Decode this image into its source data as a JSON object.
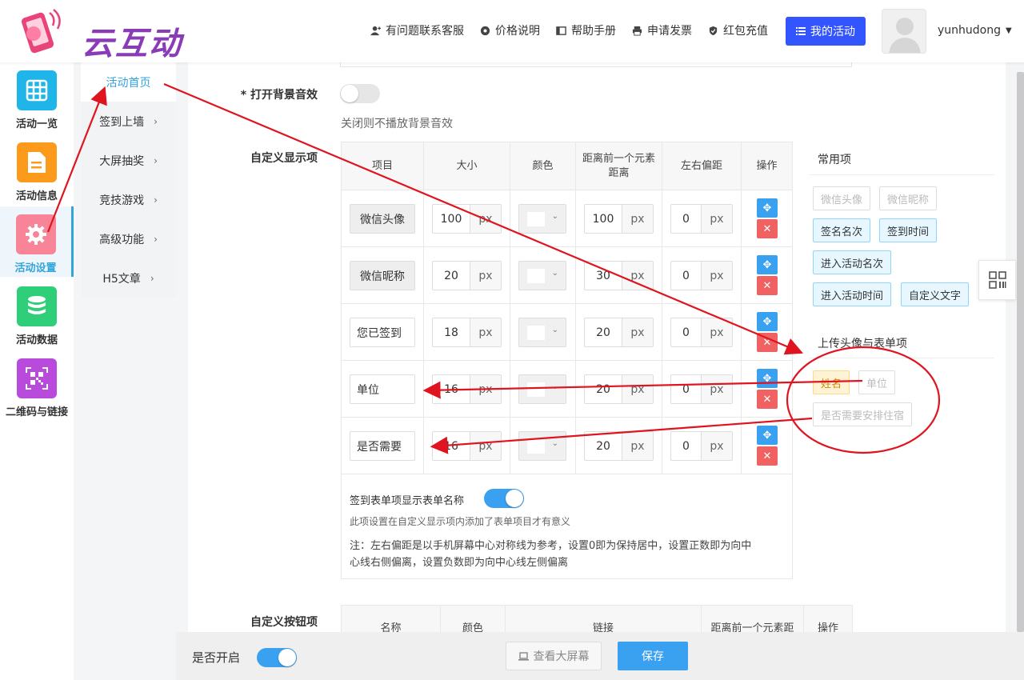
{
  "brand": {
    "name": "云互动"
  },
  "topnav": [
    {
      "label": "有问题联系客服",
      "icon": "user-plus-icon"
    },
    {
      "label": "价格说明",
      "icon": "gear-icon"
    },
    {
      "label": "帮助手册",
      "icon": "book-icon"
    },
    {
      "label": "申请发票",
      "icon": "printer-icon"
    },
    {
      "label": "红包充值",
      "icon": "shield-check-icon"
    }
  ],
  "my_activity_label": "我的活动",
  "username": "yunhudong",
  "sidenav": [
    {
      "label": "活动一览",
      "icon": "grid-icon",
      "color": "#1fb5e8"
    },
    {
      "label": "活动信息",
      "icon": "document-icon",
      "color": "#fb9a1b"
    },
    {
      "label": "活动设置",
      "icon": "gear-icon",
      "color": "#f78597",
      "active": true
    },
    {
      "label": "活动数据",
      "icon": "database-icon",
      "color": "#2fcf7a"
    },
    {
      "label": "二维码与链接",
      "icon": "qrcode-icon",
      "color": "#b84bdc"
    }
  ],
  "subnav": [
    {
      "label": "活动首页",
      "active": true
    },
    {
      "label": "签到上墙",
      "chevron": "›"
    },
    {
      "label": "大屏抽奖",
      "chevron": "›"
    },
    {
      "label": "竞技游戏",
      "chevron": "›"
    },
    {
      "label": "高级功能",
      "chevron": "›"
    },
    {
      "label": "H5文章",
      "chevron": "›"
    }
  ],
  "bgm": {
    "label": "* 打开背景音效",
    "enabled": false,
    "hint": "关闭则不播放背景音效"
  },
  "custom_display": {
    "label": "自定义显示项",
    "columns": [
      "项目",
      "大小",
      "颜色",
      "距离前一个元素距离",
      "左右偏距",
      "操作"
    ],
    "unit": "px",
    "rows": [
      {
        "name": "微信头像",
        "size": "100",
        "distance": "100",
        "offset": "0",
        "locked": true
      },
      {
        "name": "微信昵称",
        "size": "20",
        "distance": "30",
        "offset": "0",
        "locked": true
      },
      {
        "name": "您已签到",
        "size": "18",
        "distance": "20",
        "offset": "0",
        "locked": false
      },
      {
        "name": "单位",
        "size": "16",
        "distance": "20",
        "offset": "0",
        "locked": false
      },
      {
        "name": "是否需要",
        "size": "16",
        "distance": "20",
        "offset": "0",
        "locked": false
      }
    ],
    "form_name_toggle_label": "签到表单项显示表单名称",
    "form_name_toggle_on": true,
    "form_name_hint": "此项设置在自定义显示项内添加了表单项目才有意义",
    "note_line1": "注：左右偏距是以手机屏幕中心对称线为参考，设置0即为保持居中，设置正数即为向中",
    "note_line2": "心线右侧偏离，设置负数即为向中心线左侧偏离"
  },
  "common_items": {
    "title": "常用项",
    "tags": [
      {
        "label": "微信头像",
        "state": "disabled"
      },
      {
        "label": "微信昵称",
        "state": "disabled"
      },
      {
        "label": "签名名次",
        "state": "available"
      },
      {
        "label": "签到时间",
        "state": "available"
      },
      {
        "label": "进入活动名次",
        "state": "available"
      },
      {
        "label": "进入活动时间",
        "state": "available"
      },
      {
        "label": "自定义文字",
        "state": "available"
      }
    ]
  },
  "upload_items": {
    "title": "上传头像与表单项",
    "tags": [
      {
        "label": "姓名",
        "state": "available"
      },
      {
        "label": "单位",
        "state": "disabled"
      },
      {
        "label": "是否需要安排住宿",
        "state": "disabled"
      }
    ]
  },
  "custom_buttons": {
    "label": "自定义按钮项",
    "columns": [
      "名称",
      "颜色",
      "链接",
      "距离前一个元素距",
      "操作"
    ]
  },
  "footer": {
    "enable_label": "是否开启",
    "enable_on": true,
    "view_big_screen": "查看大屏幕",
    "save": "保存"
  },
  "colors": {
    "accent": "#3aa0f0",
    "primary_button": "#3355ff",
    "delete": "#f06262",
    "annotation": "#e0141e"
  }
}
